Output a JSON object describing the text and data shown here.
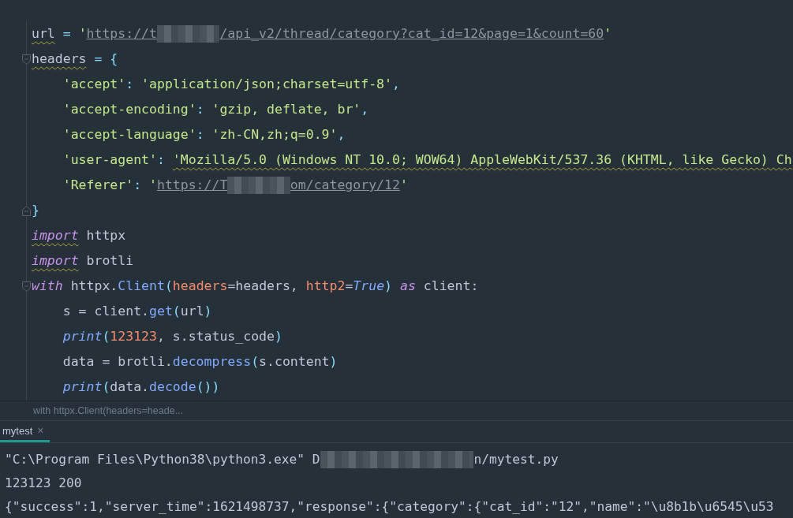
{
  "editor": {
    "lines": [
      {
        "fold_start": false,
        "fold_end": false,
        "indent": false,
        "tokens": [
          {
            "kind": "plain",
            "text": "url",
            "warn": true
          },
          {
            "kind": "punct",
            "text": " = "
          },
          {
            "kind": "string",
            "text": "'"
          },
          {
            "kind": "link",
            "text": "https://t"
          },
          {
            "kind": "blur"
          },
          {
            "kind": "link",
            "text": "/api_v2/thread/category?cat_id=12&page=1&count=60"
          },
          {
            "kind": "string",
            "text": "'"
          }
        ]
      },
      {
        "fold_start": true,
        "fold_end": false,
        "indent": false,
        "tokens": [
          {
            "kind": "plain",
            "text": "headers",
            "warn": true
          },
          {
            "kind": "punct",
            "text": " = {"
          }
        ]
      },
      {
        "fold_start": false,
        "fold_end": false,
        "indent": true,
        "tokens": [
          {
            "kind": "string",
            "text": "'accept'"
          },
          {
            "kind": "punct",
            "text": ": "
          },
          {
            "kind": "string",
            "text": "'application/json;charset=utf-8'"
          },
          {
            "kind": "punct",
            "text": ","
          }
        ]
      },
      {
        "fold_start": false,
        "fold_end": false,
        "indent": true,
        "tokens": [
          {
            "kind": "string",
            "text": "'accept-encoding'"
          },
          {
            "kind": "punct",
            "text": ": "
          },
          {
            "kind": "string",
            "text": "'gzip, deflate, br'"
          },
          {
            "kind": "punct",
            "text": ","
          }
        ]
      },
      {
        "fold_start": false,
        "fold_end": false,
        "indent": true,
        "tokens": [
          {
            "kind": "string",
            "text": "'accept-language'"
          },
          {
            "kind": "punct",
            "text": ": "
          },
          {
            "kind": "string",
            "text": "'zh-CN,zh;q=0.9'"
          },
          {
            "kind": "punct",
            "text": ","
          }
        ]
      },
      {
        "fold_start": false,
        "fold_end": false,
        "indent": true,
        "tokens": [
          {
            "kind": "string",
            "text": "'user-agent'"
          },
          {
            "kind": "punct",
            "text": ": "
          },
          {
            "kind": "string",
            "text": "'Mozilla/5.0 (Windows NT 10.0; WOW64) AppleWebKit/537.36 (KHTML, like Gecko) Ch",
            "warn": true
          }
        ]
      },
      {
        "fold_start": false,
        "fold_end": false,
        "indent": true,
        "tokens": [
          {
            "kind": "string",
            "text": "'Referer'"
          },
          {
            "kind": "punct",
            "text": ": "
          },
          {
            "kind": "string",
            "text": "'"
          },
          {
            "kind": "link",
            "text": "https://T"
          },
          {
            "kind": "blur"
          },
          {
            "kind": "link",
            "text": "om/category/12"
          },
          {
            "kind": "string",
            "text": "'"
          }
        ]
      },
      {
        "fold_start": false,
        "fold_end": true,
        "indent": false,
        "tokens": [
          {
            "kind": "punct",
            "text": "}"
          }
        ]
      },
      {
        "fold_start": false,
        "fold_end": false,
        "indent": false,
        "tokens": [
          {
            "kind": "keyword",
            "text": "import",
            "warn": true
          },
          {
            "kind": "plain",
            "text": " httpx"
          }
        ]
      },
      {
        "fold_start": false,
        "fold_end": false,
        "indent": false,
        "tokens": [
          {
            "kind": "keyword",
            "text": "import",
            "warn": true
          },
          {
            "kind": "plain",
            "text": " brotli"
          }
        ]
      },
      {
        "fold_start": true,
        "fold_end": false,
        "indent": false,
        "tokens": [
          {
            "kind": "keyword",
            "text": "with"
          },
          {
            "kind": "plain",
            "text": " httpx."
          },
          {
            "kind": "func",
            "text": "Client"
          },
          {
            "kind": "punct",
            "text": "("
          },
          {
            "kind": "param",
            "text": "headers"
          },
          {
            "kind": "plain",
            "text": "=headers, "
          },
          {
            "kind": "param",
            "text": "http2"
          },
          {
            "kind": "plain",
            "text": "="
          },
          {
            "kind": "const",
            "text": "True"
          },
          {
            "kind": "punct",
            "text": ")"
          },
          {
            "kind": "keyword",
            "text": " as"
          },
          {
            "kind": "plain",
            "text": " client:"
          }
        ]
      },
      {
        "fold_start": false,
        "fold_end": false,
        "indent": true,
        "tokens": [
          {
            "kind": "plain",
            "text": "s = client."
          },
          {
            "kind": "func",
            "text": "get"
          },
          {
            "kind": "punct",
            "text": "("
          },
          {
            "kind": "plain",
            "text": "url"
          },
          {
            "kind": "punct",
            "text": ")"
          }
        ]
      },
      {
        "fold_start": false,
        "fold_end": false,
        "indent": true,
        "tokens": [
          {
            "kind": "builtin",
            "text": "print"
          },
          {
            "kind": "punct",
            "text": "("
          },
          {
            "kind": "number",
            "text": "123123"
          },
          {
            "kind": "plain",
            "text": ", s.status_code"
          },
          {
            "kind": "punct",
            "text": ")"
          }
        ]
      },
      {
        "fold_start": false,
        "fold_end": false,
        "indent": true,
        "tokens": [
          {
            "kind": "plain",
            "text": "data = brotli."
          },
          {
            "kind": "func",
            "text": "decompress"
          },
          {
            "kind": "punct",
            "text": "("
          },
          {
            "kind": "plain",
            "text": "s.content"
          },
          {
            "kind": "punct",
            "text": ")"
          }
        ]
      },
      {
        "fold_start": false,
        "fold_end": false,
        "indent": true,
        "tokens": [
          {
            "kind": "builtin",
            "text": "print"
          },
          {
            "kind": "punct",
            "text": "("
          },
          {
            "kind": "plain",
            "text": "data."
          },
          {
            "kind": "func",
            "text": "decode"
          },
          {
            "kind": "punct",
            "text": "())"
          }
        ]
      }
    ]
  },
  "breadcrumb": "with httpx.Client(headers=heade...",
  "run_tabs": [
    {
      "label": "mytest",
      "close": "×",
      "selected": true
    }
  ],
  "console": {
    "lines": [
      {
        "tokens": [
          {
            "kind": "text",
            "text": "\"C:\\Program Files\\Python38\\python3.exe\" D"
          },
          {
            "kind": "blur"
          },
          {
            "kind": "text",
            "text": "n/mytest.py"
          }
        ]
      },
      {
        "tokens": [
          {
            "kind": "text",
            "text": "123123 200"
          }
        ]
      },
      {
        "tokens": [
          {
            "kind": "text",
            "text": "{\"success\":1,\"server_time\":1621498737,\"response\":{\"category\":{\"cat_id\":\"12\",\"name\":\"\\u8b1b\\u6545\\u53"
          }
        ]
      }
    ]
  }
}
